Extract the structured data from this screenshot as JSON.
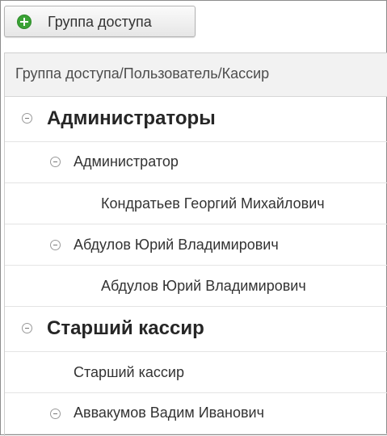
{
  "toolbar": {
    "add_group_label": "Группа доступа",
    "add_icon": "plus-circle-icon",
    "accent_color": "#3aa235"
  },
  "table": {
    "column_header": "Группа доступа/Пользователь/Кассир",
    "rows": [
      {
        "text": "Администраторы",
        "level": 0,
        "expanded": true
      },
      {
        "text": "Администратор",
        "level": 1,
        "expanded": true
      },
      {
        "text": "Кондратьев Георгий Михайлович",
        "level": 2
      },
      {
        "text": "Абдулов Юрий Владимирович",
        "level": 1,
        "expanded": true
      },
      {
        "text": "Абдулов Юрий Владимирович",
        "level": 2
      },
      {
        "text": "Старший кассир",
        "level": 0,
        "expanded": true
      },
      {
        "text": "Старший кассир",
        "level": 1
      },
      {
        "text": "Аввакумов Вадим Иванович",
        "level": 1,
        "expanded": true
      }
    ]
  }
}
